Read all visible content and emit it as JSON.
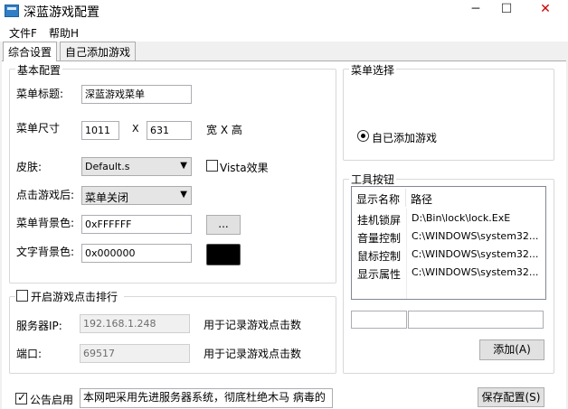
{
  "window": {
    "title": "深蓝游戏配置",
    "min": "─",
    "max": "☐",
    "close": "✕",
    "accent": "#2f7fc8"
  },
  "menu": {
    "file": "文件F",
    "help": "帮助H"
  },
  "tabs": {
    "general": "综合设置",
    "custom": "自己添加游戏"
  },
  "basic": {
    "legend": "基本配置",
    "menu_title_label": "菜单标题:",
    "menu_title_value": "深蓝游戏菜单",
    "menu_size_label": "菜单尺寸",
    "width": "1011",
    "x": "X",
    "height": "631",
    "size_unit": "宽 X 高",
    "skin_label": "皮肤:",
    "skin_value": "Default.s",
    "vista_label": "Vista效果",
    "click_label": "点击游戏后:",
    "click_value": "菜单关闭",
    "bg_label": "菜单背景色:",
    "bg_value": "0xFFFFFF",
    "browse": "...",
    "text_bg_label": "文字背景色:",
    "text_bg_value": "0x000000",
    "text_bg_swatch": "#000000"
  },
  "ranking": {
    "enable_label": "开启游戏点击排行",
    "server_label": "服务器IP:",
    "server_value": "192.168.1.248",
    "server_hint": "用于记录游戏点击数",
    "port_label": "端口:",
    "port_value": "69517",
    "port_hint": "用于记录游戏点击数"
  },
  "menu_select": {
    "legend": "菜单选择",
    "option": "自已添加游戏"
  },
  "tools": {
    "legend": "工具按钮",
    "columns": [
      "显示名称",
      "路径"
    ],
    "rows": [
      {
        "name": "挂机锁屏",
        "path": "D:\\Bin\\lock\\lock.ExE"
      },
      {
        "name": "音量控制",
        "path": "C:\\WINDOWS\\system32..."
      },
      {
        "name": "鼠标控制",
        "path": "C:\\WINDOWS\\system32..."
      },
      {
        "name": "显示属性",
        "path": "C:\\WINDOWS\\system32..."
      }
    ],
    "add_button": "添加(A)"
  },
  "notice": {
    "label": "公告启用",
    "text": "本网吧采用先进服务器系统，彻底杜绝木马 病毒的",
    "save_button": "保存配置(S)"
  }
}
